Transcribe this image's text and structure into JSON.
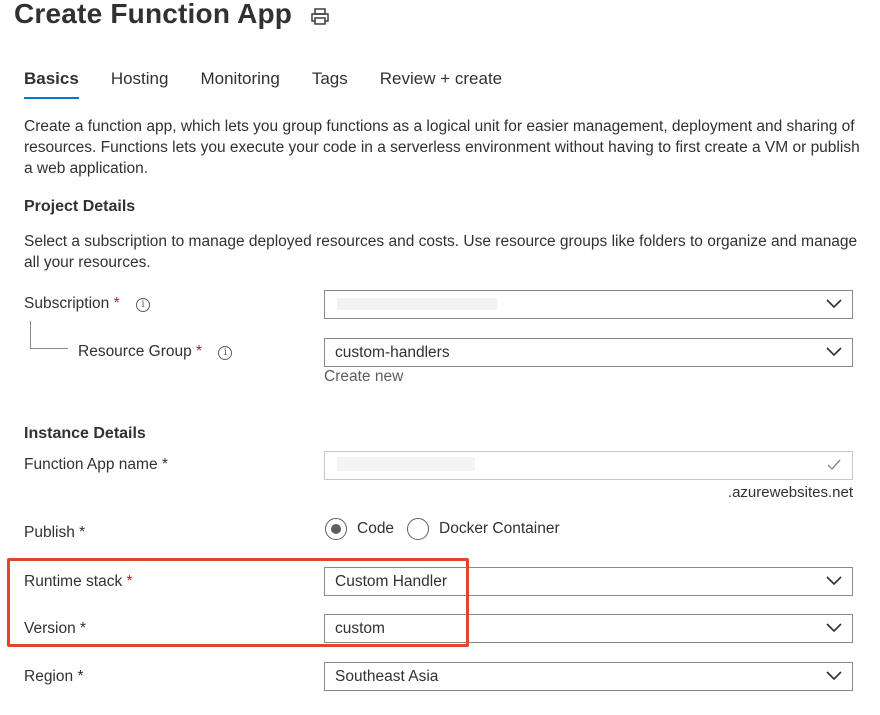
{
  "header": {
    "title": "Create Function App",
    "print_icon": "print-icon"
  },
  "tabs": [
    {
      "label": "Basics",
      "active": true
    },
    {
      "label": "Hosting",
      "active": false
    },
    {
      "label": "Monitoring",
      "active": false
    },
    {
      "label": "Tags",
      "active": false
    },
    {
      "label": "Review + create",
      "active": false
    }
  ],
  "intro": "Create a function app, which lets you group functions as a logical unit for easier management, deployment and sharing of resources. Functions lets you execute your code in a serverless environment without having to first create a VM or publish a web application.",
  "project": {
    "heading": "Project Details",
    "description": "Select a subscription to manage deployed resources and costs. Use resource groups like folders to organize and manage all your resources.",
    "subscription": {
      "label": "Subscription",
      "required": "*",
      "info": "i",
      "value": ""
    },
    "resource_group": {
      "label": "Resource Group",
      "required": "*",
      "info": "i",
      "value": "custom-handlers",
      "create_new": "Create new"
    }
  },
  "instance": {
    "heading": "Instance Details",
    "function_app_name": {
      "label": "Function App name",
      "required": "*",
      "value": "",
      "suffix": ".azurewebsites.net"
    },
    "publish": {
      "label": "Publish",
      "required": "*",
      "options": [
        "Code",
        "Docker Container"
      ],
      "selected": "Code"
    },
    "runtime_stack": {
      "label": "Runtime stack",
      "required": "*",
      "value": "Custom Handler"
    },
    "version": {
      "label": "Version",
      "required": "*",
      "value": "custom"
    },
    "region": {
      "label": "Region",
      "required": "*",
      "value": "Southeast Asia"
    }
  },
  "colors": {
    "accent": "#0078d4",
    "required": "#a4262c",
    "highlight": "#e0452f"
  }
}
